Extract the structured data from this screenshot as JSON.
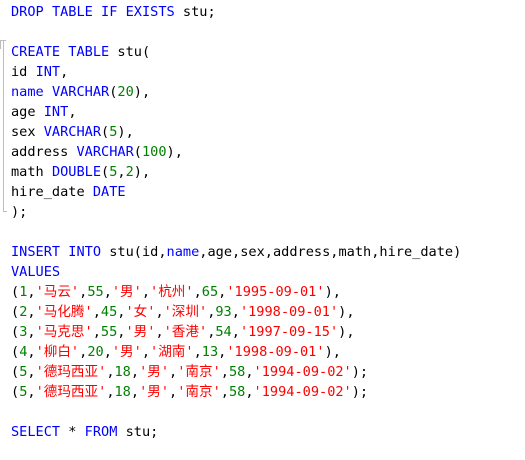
{
  "editor": {
    "language": "sql",
    "colors": {
      "keyword": "#0000ff",
      "identifier": "#000000",
      "number": "#008000",
      "string": "#ff0000",
      "fold_guide": "#bdbdbd"
    },
    "lines": [
      [
        {
          "t": "DROP",
          "k": "kw"
        },
        {
          "t": " ",
          "k": "pun"
        },
        {
          "t": "TABLE",
          "k": "kw"
        },
        {
          "t": " ",
          "k": "pun"
        },
        {
          "t": "IF",
          "k": "kw"
        },
        {
          "t": " ",
          "k": "pun"
        },
        {
          "t": "EXISTS",
          "k": "kw"
        },
        {
          "t": " ",
          "k": "pun"
        },
        {
          "t": "stu",
          "k": "id"
        },
        {
          "t": ";",
          "k": "pun"
        }
      ],
      [],
      [
        {
          "t": "CREATE",
          "k": "kw"
        },
        {
          "t": " ",
          "k": "pun"
        },
        {
          "t": "TABLE",
          "k": "kw"
        },
        {
          "t": " ",
          "k": "pun"
        },
        {
          "t": "stu",
          "k": "id"
        },
        {
          "t": "(",
          "k": "pun"
        }
      ],
      [
        {
          "t": "id",
          "k": "id"
        },
        {
          "t": " ",
          "k": "pun"
        },
        {
          "t": "INT",
          "k": "kw"
        },
        {
          "t": ",",
          "k": "pun"
        }
      ],
      [
        {
          "t": "name",
          "k": "kw"
        },
        {
          "t": " ",
          "k": "pun"
        },
        {
          "t": "VARCHAR",
          "k": "kw"
        },
        {
          "t": "(",
          "k": "pun"
        },
        {
          "t": "20",
          "k": "num"
        },
        {
          "t": "),",
          "k": "pun"
        }
      ],
      [
        {
          "t": "age",
          "k": "id"
        },
        {
          "t": " ",
          "k": "pun"
        },
        {
          "t": "INT",
          "k": "kw"
        },
        {
          "t": ",",
          "k": "pun"
        }
      ],
      [
        {
          "t": "sex",
          "k": "id"
        },
        {
          "t": " ",
          "k": "pun"
        },
        {
          "t": "VARCHAR",
          "k": "kw"
        },
        {
          "t": "(",
          "k": "pun"
        },
        {
          "t": "5",
          "k": "num"
        },
        {
          "t": "),",
          "k": "pun"
        }
      ],
      [
        {
          "t": "address",
          "k": "id"
        },
        {
          "t": " ",
          "k": "pun"
        },
        {
          "t": "VARCHAR",
          "k": "kw"
        },
        {
          "t": "(",
          "k": "pun"
        },
        {
          "t": "100",
          "k": "num"
        },
        {
          "t": "),",
          "k": "pun"
        }
      ],
      [
        {
          "t": "math",
          "k": "id"
        },
        {
          "t": " ",
          "k": "pun"
        },
        {
          "t": "DOUBLE",
          "k": "kw"
        },
        {
          "t": "(",
          "k": "pun"
        },
        {
          "t": "5",
          "k": "num"
        },
        {
          "t": ",",
          "k": "pun"
        },
        {
          "t": "2",
          "k": "num"
        },
        {
          "t": "),",
          "k": "pun"
        }
      ],
      [
        {
          "t": "hire_date",
          "k": "id"
        },
        {
          "t": " ",
          "k": "pun"
        },
        {
          "t": "DATE",
          "k": "kw"
        }
      ],
      [
        {
          "t": ");",
          "k": "pun"
        }
      ],
      [],
      [
        {
          "t": "INSERT",
          "k": "kw"
        },
        {
          "t": " ",
          "k": "pun"
        },
        {
          "t": "INTO",
          "k": "kw"
        },
        {
          "t": " ",
          "k": "pun"
        },
        {
          "t": "stu",
          "k": "id"
        },
        {
          "t": "(",
          "k": "pun"
        },
        {
          "t": "id",
          "k": "id"
        },
        {
          "t": ",",
          "k": "pun"
        },
        {
          "t": "name",
          "k": "kw"
        },
        {
          "t": ",",
          "k": "pun"
        },
        {
          "t": "age",
          "k": "id"
        },
        {
          "t": ",",
          "k": "pun"
        },
        {
          "t": "sex",
          "k": "id"
        },
        {
          "t": ",",
          "k": "pun"
        },
        {
          "t": "address",
          "k": "id"
        },
        {
          "t": ",",
          "k": "pun"
        },
        {
          "t": "math",
          "k": "id"
        },
        {
          "t": ",",
          "k": "pun"
        },
        {
          "t": "hire_date",
          "k": "id"
        },
        {
          "t": ")",
          "k": "pun"
        }
      ],
      [
        {
          "t": "VALUES",
          "k": "kw"
        }
      ],
      [
        {
          "t": "(",
          "k": "pun"
        },
        {
          "t": "1",
          "k": "num"
        },
        {
          "t": ",",
          "k": "pun"
        },
        {
          "t": "'马云'",
          "k": "str"
        },
        {
          "t": ",",
          "k": "pun"
        },
        {
          "t": "55",
          "k": "num"
        },
        {
          "t": ",",
          "k": "pun"
        },
        {
          "t": "'男'",
          "k": "str"
        },
        {
          "t": ",",
          "k": "pun"
        },
        {
          "t": "'杭州'",
          "k": "str"
        },
        {
          "t": ",",
          "k": "pun"
        },
        {
          "t": "65",
          "k": "num"
        },
        {
          "t": ",",
          "k": "pun"
        },
        {
          "t": "'1995-09-01'",
          "k": "str"
        },
        {
          "t": "),",
          "k": "pun"
        }
      ],
      [
        {
          "t": "(",
          "k": "pun"
        },
        {
          "t": "2",
          "k": "num"
        },
        {
          "t": ",",
          "k": "pun"
        },
        {
          "t": "'马化腾'",
          "k": "str"
        },
        {
          "t": ",",
          "k": "pun"
        },
        {
          "t": "45",
          "k": "num"
        },
        {
          "t": ",",
          "k": "pun"
        },
        {
          "t": "'女'",
          "k": "str"
        },
        {
          "t": ",",
          "k": "pun"
        },
        {
          "t": "'深圳'",
          "k": "str"
        },
        {
          "t": ",",
          "k": "pun"
        },
        {
          "t": "93",
          "k": "num"
        },
        {
          "t": ",",
          "k": "pun"
        },
        {
          "t": "'1998-09-01'",
          "k": "str"
        },
        {
          "t": "),",
          "k": "pun"
        }
      ],
      [
        {
          "t": "(",
          "k": "pun"
        },
        {
          "t": "3",
          "k": "num"
        },
        {
          "t": ",",
          "k": "pun"
        },
        {
          "t": "'马克思'",
          "k": "str"
        },
        {
          "t": ",",
          "k": "pun"
        },
        {
          "t": "55",
          "k": "num"
        },
        {
          "t": ",",
          "k": "pun"
        },
        {
          "t": "'男'",
          "k": "str"
        },
        {
          "t": ",",
          "k": "pun"
        },
        {
          "t": "'香港'",
          "k": "str"
        },
        {
          "t": ",",
          "k": "pun"
        },
        {
          "t": "54",
          "k": "num"
        },
        {
          "t": ",",
          "k": "pun"
        },
        {
          "t": "'1997-09-15'",
          "k": "str"
        },
        {
          "t": "),",
          "k": "pun"
        }
      ],
      [
        {
          "t": "(",
          "k": "pun"
        },
        {
          "t": "4",
          "k": "num"
        },
        {
          "t": ",",
          "k": "pun"
        },
        {
          "t": "'柳白'",
          "k": "str"
        },
        {
          "t": ",",
          "k": "pun"
        },
        {
          "t": "20",
          "k": "num"
        },
        {
          "t": ",",
          "k": "pun"
        },
        {
          "t": "'男'",
          "k": "str"
        },
        {
          "t": ",",
          "k": "pun"
        },
        {
          "t": "'湖南'",
          "k": "str"
        },
        {
          "t": ",",
          "k": "pun"
        },
        {
          "t": "13",
          "k": "num"
        },
        {
          "t": ",",
          "k": "pun"
        },
        {
          "t": "'1998-09-01'",
          "k": "str"
        },
        {
          "t": "),",
          "k": "pun"
        }
      ],
      [
        {
          "t": "(",
          "k": "pun"
        },
        {
          "t": "5",
          "k": "num"
        },
        {
          "t": ",",
          "k": "pun"
        },
        {
          "t": "'德玛西亚'",
          "k": "str"
        },
        {
          "t": ",",
          "k": "pun"
        },
        {
          "t": "18",
          "k": "num"
        },
        {
          "t": ",",
          "k": "pun"
        },
        {
          "t": "'男'",
          "k": "str"
        },
        {
          "t": ",",
          "k": "pun"
        },
        {
          "t": "'南京'",
          "k": "str"
        },
        {
          "t": ",",
          "k": "pun"
        },
        {
          "t": "58",
          "k": "num"
        },
        {
          "t": ",",
          "k": "pun"
        },
        {
          "t": "'1994-09-02'",
          "k": "str"
        },
        {
          "t": ");",
          "k": "pun"
        }
      ],
      [
        {
          "t": "(",
          "k": "pun"
        },
        {
          "t": "5",
          "k": "num"
        },
        {
          "t": ",",
          "k": "pun"
        },
        {
          "t": "'德玛西亚'",
          "k": "str"
        },
        {
          "t": ",",
          "k": "pun"
        },
        {
          "t": "18",
          "k": "num"
        },
        {
          "t": ",",
          "k": "pun"
        },
        {
          "t": "'男'",
          "k": "str"
        },
        {
          "t": ",",
          "k": "pun"
        },
        {
          "t": "'南京'",
          "k": "str"
        },
        {
          "t": ",",
          "k": "pun"
        },
        {
          "t": "58",
          "k": "num"
        },
        {
          "t": ",",
          "k": "pun"
        },
        {
          "t": "'1994-09-02'",
          "k": "str"
        },
        {
          "t": ");",
          "k": "pun"
        }
      ],
      [],
      [
        {
          "t": "SELECT",
          "k": "kw"
        },
        {
          "t": " ",
          "k": "pun"
        },
        {
          "t": "*",
          "k": "pun"
        },
        {
          "t": " ",
          "k": "pun"
        },
        {
          "t": "FROM",
          "k": "kw"
        },
        {
          "t": " ",
          "k": "pun"
        },
        {
          "t": "stu",
          "k": "id"
        },
        {
          "t": ";",
          "k": "pun"
        }
      ]
    ]
  }
}
